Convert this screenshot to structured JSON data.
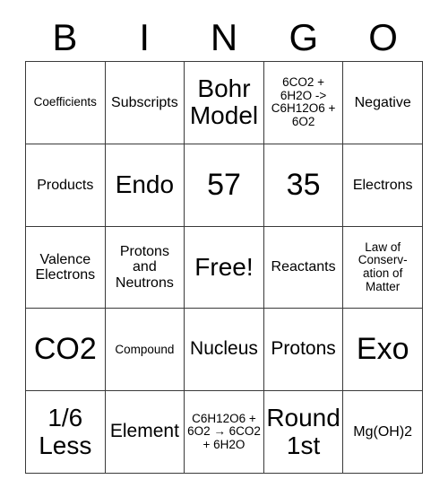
{
  "card": {
    "title": "BINGO",
    "header_letters": [
      "B",
      "I",
      "N",
      "G",
      "O"
    ],
    "free_space_label": "Free!",
    "grid": [
      [
        {
          "text": "Coefficients",
          "size": "xs"
        },
        {
          "text": "Subscripts",
          "size": "sm"
        },
        {
          "text": "Bohr Model",
          "size": "lg"
        },
        {
          "text": "6CO2 + 6H2O -> C6H12O6 + 6O2",
          "size": "xs"
        },
        {
          "text": "Negative",
          "size": "sm"
        }
      ],
      [
        {
          "text": "Products",
          "size": "sm"
        },
        {
          "text": "Endo",
          "size": "lg"
        },
        {
          "text": "57",
          "size": "xl"
        },
        {
          "text": "35",
          "size": "xl"
        },
        {
          "text": "Electrons",
          "size": "sm"
        }
      ],
      [
        {
          "text": "Valence Electrons",
          "size": "sm"
        },
        {
          "text": "Protons and Neutrons",
          "size": "sm"
        },
        {
          "text": "Free!",
          "size": "lg"
        },
        {
          "text": "Reactants",
          "size": "sm"
        },
        {
          "text": "Law of Conserv- ation of Matter",
          "size": "xs"
        }
      ],
      [
        {
          "text": "CO2",
          "size": "xl"
        },
        {
          "text": "Compound",
          "size": "xs"
        },
        {
          "text": "Nucleus",
          "size": "md"
        },
        {
          "text": "Protons",
          "size": "md"
        },
        {
          "text": "Exo",
          "size": "xl"
        }
      ],
      [
        {
          "text": "1/6 Less",
          "size": "lg"
        },
        {
          "text": "Element",
          "size": "md"
        },
        {
          "text": "C6H12O6 + 6O2 → 6CO2 + 6H2O",
          "size": "xs"
        },
        {
          "text": "Round 1st",
          "size": "lg"
        },
        {
          "text": "Mg(OH)2",
          "size": "sm"
        }
      ]
    ]
  },
  "colors": {
    "background": "#ffffff",
    "text": "#000000",
    "grid_line": "#3a3a3a"
  }
}
